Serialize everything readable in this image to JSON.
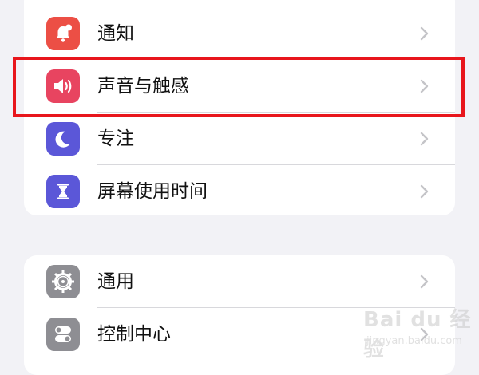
{
  "group1": {
    "items": [
      {
        "label": "通知",
        "icon": "bell-badge-icon",
        "color": "#ec4f45"
      },
      {
        "label": "声音与触感",
        "icon": "speaker-icon",
        "color": "#e84460"
      },
      {
        "label": "专注",
        "icon": "moon-icon",
        "color": "#5b57d8"
      },
      {
        "label": "屏幕使用时间",
        "icon": "hourglass-icon",
        "color": "#5b57d8"
      }
    ]
  },
  "group2": {
    "items": [
      {
        "label": "通用",
        "icon": "gear-icon",
        "color": "#8e8e93"
      },
      {
        "label": "控制中心",
        "icon": "toggles-icon",
        "color": "#8e8e93"
      }
    ]
  },
  "highlight": {
    "color": "#e8161c"
  },
  "watermark": {
    "brand": "Bai du 经验",
    "url": "jingyan.baidu.com"
  }
}
